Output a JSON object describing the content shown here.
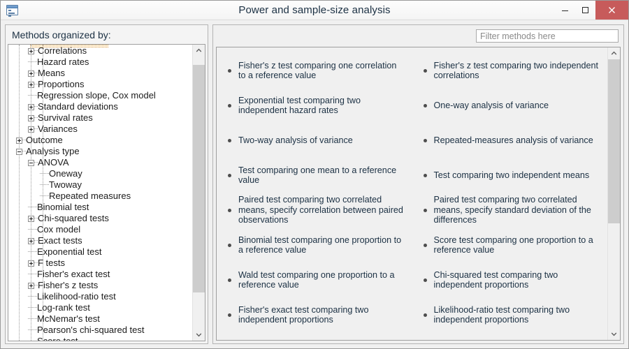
{
  "window": {
    "title": "Power and sample-size analysis",
    "app_icon": "window-list-icon",
    "controls": {
      "minimize_label": "Minimize",
      "maximize_label": "Maximize",
      "close_label": "Close"
    },
    "accent_close_color": "#c75b5b"
  },
  "left_panel": {
    "label": "Methods organized by:",
    "tree": [
      {
        "label": "Correlations",
        "depth": 1,
        "toggle": "plus"
      },
      {
        "label": "Hazard rates",
        "depth": 1,
        "toggle": "leaf"
      },
      {
        "label": "Means",
        "depth": 1,
        "toggle": "plus"
      },
      {
        "label": "Proportions",
        "depth": 1,
        "toggle": "plus"
      },
      {
        "label": "Regression slope, Cox model",
        "depth": 1,
        "toggle": "leaf"
      },
      {
        "label": "Standard deviations",
        "depth": 1,
        "toggle": "plus"
      },
      {
        "label": "Survival rates",
        "depth": 1,
        "toggle": "plus"
      },
      {
        "label": "Variances",
        "depth": 1,
        "toggle": "plus"
      },
      {
        "label": "Outcome",
        "depth": 0,
        "toggle": "plus"
      },
      {
        "label": "Analysis type",
        "depth": 0,
        "toggle": "minus"
      },
      {
        "label": "ANOVA",
        "depth": 1,
        "toggle": "minus"
      },
      {
        "label": "Oneway",
        "depth": 2,
        "toggle": "leaf"
      },
      {
        "label": "Twoway",
        "depth": 2,
        "toggle": "leaf"
      },
      {
        "label": "Repeated measures",
        "depth": 2,
        "toggle": "leaf"
      },
      {
        "label": "Binomial test",
        "depth": 1,
        "toggle": "leaf"
      },
      {
        "label": "Chi-squared tests",
        "depth": 1,
        "toggle": "plus"
      },
      {
        "label": "Cox model",
        "depth": 1,
        "toggle": "leaf"
      },
      {
        "label": "Exact tests",
        "depth": 1,
        "toggle": "plus"
      },
      {
        "label": "Exponential test",
        "depth": 1,
        "toggle": "leaf"
      },
      {
        "label": "F tests",
        "depth": 1,
        "toggle": "plus"
      },
      {
        "label": "Fisher's exact test",
        "depth": 1,
        "toggle": "leaf"
      },
      {
        "label": "Fisher's z tests",
        "depth": 1,
        "toggle": "plus"
      },
      {
        "label": "Likelihood-ratio test",
        "depth": 1,
        "toggle": "leaf"
      },
      {
        "label": "Log-rank test",
        "depth": 1,
        "toggle": "leaf"
      },
      {
        "label": "McNemar's test",
        "depth": 1,
        "toggle": "leaf"
      },
      {
        "label": "Pearson's chi-squared test",
        "depth": 1,
        "toggle": "leaf"
      },
      {
        "label": "Score test",
        "depth": 1,
        "toggle": "leaf"
      }
    ],
    "scrollbar": {
      "up_arrow": "chevron-up-icon",
      "down_arrow": "chevron-down-icon"
    }
  },
  "right_panel": {
    "filter": {
      "value": "",
      "placeholder": "Filter methods here"
    },
    "methods": [
      "Fisher's z test comparing one correlation to a reference value",
      "Fisher's z test comparing two independent correlations",
      "Exponential test comparing two independent hazard rates",
      "One-way analysis of variance",
      "Two-way analysis of variance",
      "Repeated-measures analysis of variance",
      "Test comparing one mean to a reference value",
      "Test comparing two independent means",
      "Paired test comparing two correlated means, specify correlation between paired observations",
      "Paired test comparing two correlated means, specify standard deviation of the differences",
      "Binomial test comparing one proportion to a reference value",
      "Score test comparing one proportion to a reference value",
      "Wald test comparing one proportion to a reference value",
      "Chi-squared test comparing two independent proportions",
      "Fisher's exact test comparing two independent proportions",
      "Likelihood-ratio test comparing two independent proportions"
    ],
    "scrollbar": {
      "up_arrow": "chevron-up-icon",
      "down_arrow": "chevron-down-icon"
    }
  }
}
